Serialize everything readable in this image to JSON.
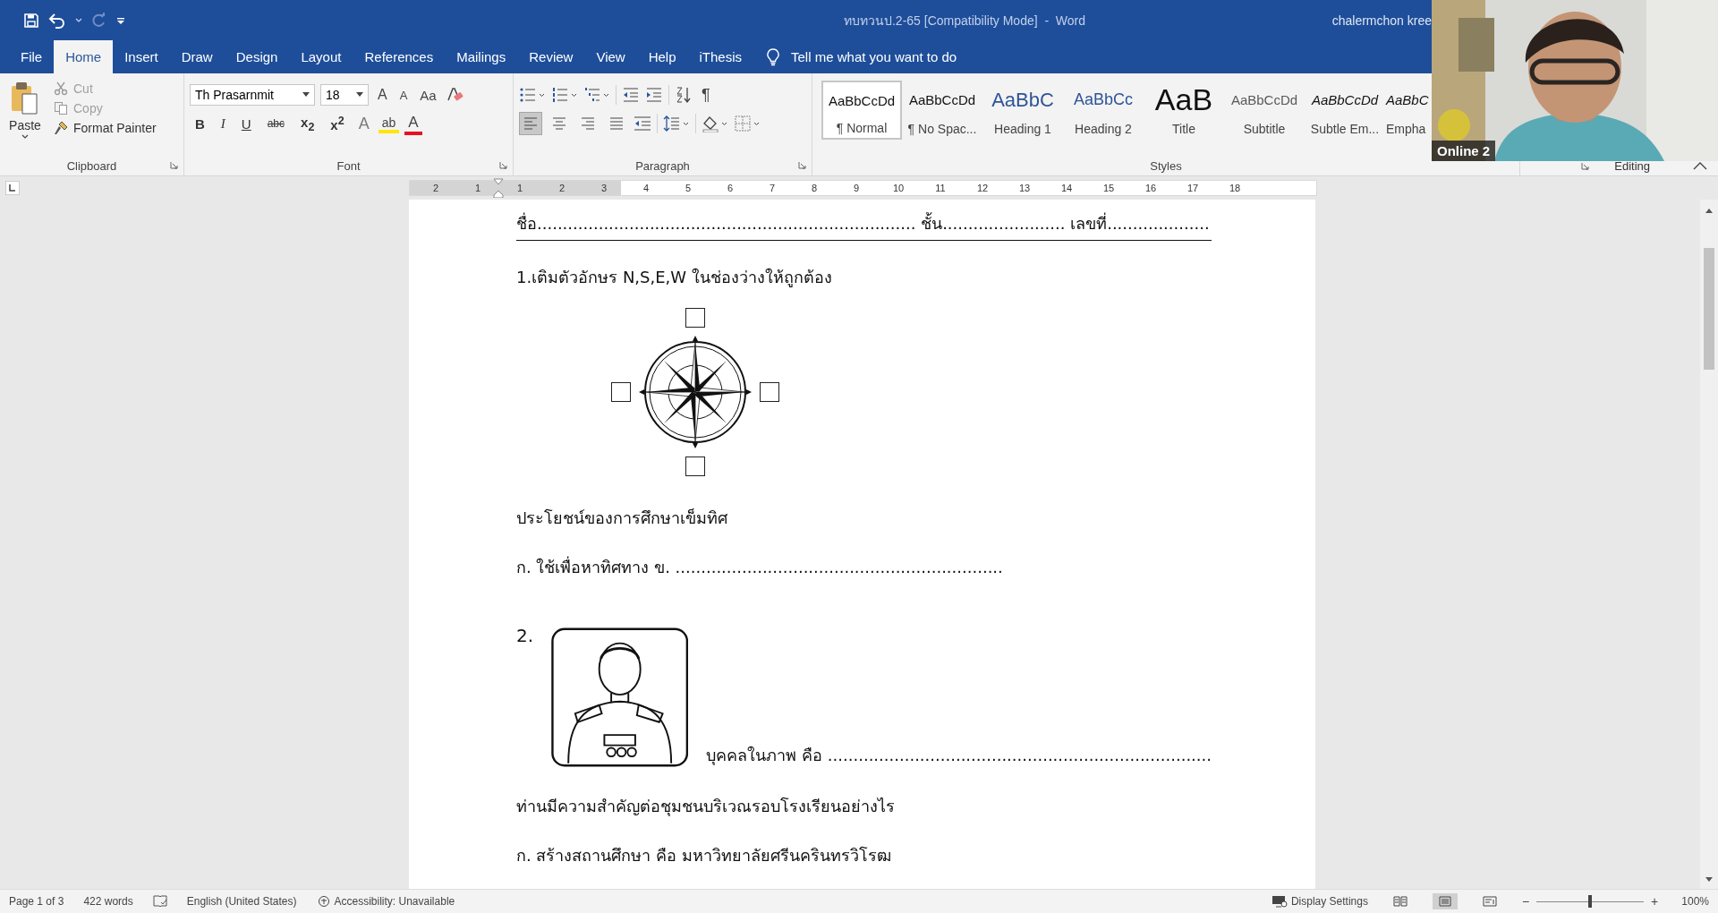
{
  "window": {
    "title": "ทบทวนป.2-65 [Compatibility Mode]  -  Word",
    "user": "chalermchon kree"
  },
  "tabs": [
    {
      "label": "File",
      "selected": false
    },
    {
      "label": "Home",
      "selected": true
    },
    {
      "label": "Insert",
      "selected": false
    },
    {
      "label": "Draw",
      "selected": false
    },
    {
      "label": "Design",
      "selected": false
    },
    {
      "label": "Layout",
      "selected": false
    },
    {
      "label": "References",
      "selected": false
    },
    {
      "label": "Mailings",
      "selected": false
    },
    {
      "label": "Review",
      "selected": false
    },
    {
      "label": "View",
      "selected": false
    },
    {
      "label": "Help",
      "selected": false
    },
    {
      "label": "iThesis",
      "selected": false
    }
  ],
  "tell_me": {
    "placeholder": "Tell me what you want to do"
  },
  "clipboard": {
    "paste": "Paste",
    "cut": {
      "label": "Cut",
      "disabled": true
    },
    "copy": {
      "label": "Copy",
      "disabled": true
    },
    "format_painter": "Format Painter",
    "title": "Clipboard"
  },
  "font": {
    "name": "Th Prasarnmit",
    "size": "18",
    "grow": "A",
    "shrink": "A",
    "change_case": "Aa",
    "text_effects": "A",
    "highlight": "ab",
    "font_color": "A",
    "title": "Font",
    "format_buttons": [
      {
        "label": "B",
        "kind": "bold"
      },
      {
        "label": "I",
        "kind": "italic"
      },
      {
        "label": "U",
        "kind": "underline"
      },
      {
        "label": "abc",
        "kind": "strike"
      },
      {
        "label": "x$_{2}$",
        "kind": "sub"
      },
      {
        "label": "x$^{2}$",
        "kind": "sup"
      }
    ]
  },
  "paragraph": {
    "pilcrow": "¶",
    "title": "Paragraph",
    "align": [
      {
        "kind": "left",
        "selected": true
      },
      {
        "kind": "center",
        "selected": false
      },
      {
        "kind": "right",
        "selected": false
      },
      {
        "kind": "justify",
        "selected": false
      }
    ]
  },
  "styles": {
    "title": "Styles",
    "items": [
      {
        "preview": "AaBbCcDd",
        "name": "¶ Normal",
        "kind": "normal",
        "selected": true
      },
      {
        "preview": "AaBbCcDd",
        "name": "¶ No Spac...",
        "kind": "normal",
        "selected": false
      },
      {
        "preview": "AaBbC",
        "name": "Heading 1",
        "kind": "heading1",
        "selected": false
      },
      {
        "preview": "AaBbCc",
        "name": "Heading 2",
        "kind": "heading2",
        "selected": false
      },
      {
        "preview": "AaB",
        "name": "Title",
        "kind": "title",
        "selected": false
      },
      {
        "preview": "AaBbCcDd",
        "name": "Subtitle",
        "kind": "subtitle",
        "selected": false
      },
      {
        "preview": "AaBbCcDd",
        "name": "Subtle Em...",
        "kind": "emphasis",
        "selected": false
      },
      {
        "preview": "AaBbC",
        "name": "Empha",
        "kind": "emphasis",
        "selected": false
      }
    ]
  },
  "editing": "Editing",
  "ruler": {
    "marks": [
      "2",
      "1",
      "1",
      "2",
      "3",
      "4",
      "5",
      "6",
      "7",
      "8",
      "9",
      "10",
      "11",
      "12",
      "13",
      "14",
      "15",
      "16",
      "17",
      "18"
    ]
  },
  "document": {
    "blocks": [
      {
        "kind": "header",
        "text": "ชื่อ.......................................................................... ชั้น........................ เลขที่...................."
      },
      {
        "kind": "text",
        "text": "1.เติมตัวอักษร N,S,E,W ในช่องว่างให้ถูกต้อง"
      },
      {
        "kind": "compass"
      },
      {
        "kind": "text",
        "text": "ประโยชน์ของการศึกษาเข็มทิศ"
      },
      {
        "kind": "text",
        "text": "ก. ใช้เพื่อหาทิศทาง   ข. ................................................................"
      },
      {
        "kind": "portrait",
        "number": "2.",
        "caption": "บุคคลในภาพ คือ ..........................................................................."
      },
      {
        "kind": "text",
        "text": "ท่านมีความสำคัญต่อชุมชนบริเวณรอบโรงเรียนอย่างไร"
      },
      {
        "kind": "text",
        "text": "ก. สร้างสถานศึกษา คือ มหาวิทยาลัยศรีนครินทรวิโรฒ"
      }
    ]
  },
  "video": {
    "label": "Online 2"
  },
  "status_bar": {
    "page": "Page 1 of 3",
    "words": "422 words",
    "language": "English (United States)",
    "accessibility": "Accessibility: Unavailable",
    "display_settings": "Display Settings",
    "views": [
      {
        "kind": "read",
        "selected": false
      },
      {
        "kind": "print",
        "selected": true
      },
      {
        "kind": "web",
        "selected": false
      }
    ],
    "zoom": {
      "minus": "−",
      "plus": "+",
      "level": 0.5,
      "reading": "100%"
    }
  }
}
